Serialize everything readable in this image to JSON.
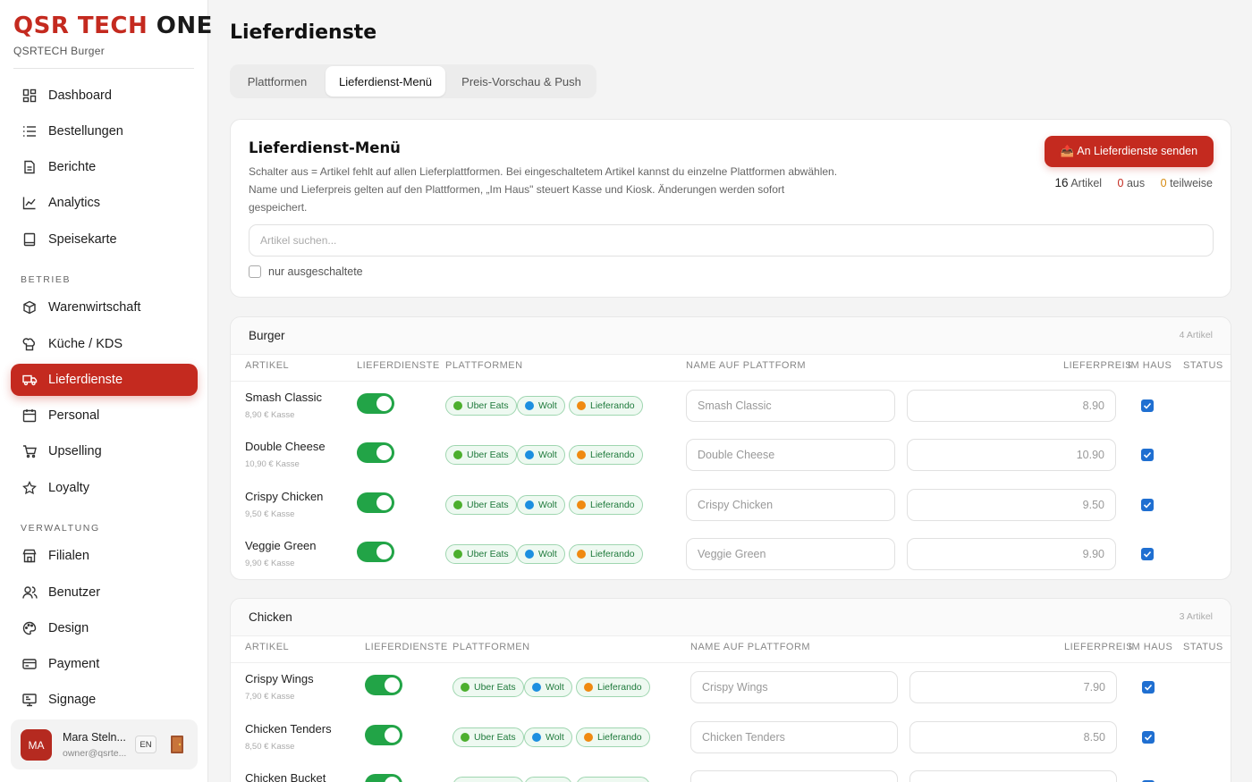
{
  "sidebar": {
    "brand": {
      "part1": "QSR TECH ",
      "part2": "ONE"
    },
    "subtitle": "QSRTECH Burger",
    "items": [
      {
        "label": "Dashboard",
        "icon": "dashboard-icon"
      },
      {
        "label": "Bestellungen",
        "icon": "list-icon"
      },
      {
        "label": "Berichte",
        "icon": "document-icon"
      },
      {
        "label": "Analytics",
        "icon": "chart-line-icon"
      },
      {
        "label": "Speisekarte",
        "icon": "book-icon"
      }
    ],
    "section_betrieb": "BETRIEB",
    "betrieb_items": [
      {
        "label": "Warenwirtschaft",
        "icon": "box-icon"
      },
      {
        "label": "Küche / KDS",
        "icon": "chef-hat-icon"
      },
      {
        "label": "Lieferdienste",
        "icon": "truck-icon"
      },
      {
        "label": "Personal",
        "icon": "calendar-icon"
      },
      {
        "label": "Upselling",
        "icon": "cart-icon"
      },
      {
        "label": "Loyalty",
        "icon": "star-icon"
      }
    ],
    "section_verwaltung": "VERWALTUNG",
    "verwaltung_items": [
      {
        "label": "Filialen",
        "icon": "store-icon"
      },
      {
        "label": "Benutzer",
        "icon": "users-icon"
      },
      {
        "label": "Design",
        "icon": "palette-icon"
      },
      {
        "label": "Payment",
        "icon": "credit-card-icon"
      },
      {
        "label": "Signage",
        "icon": "monitor-icon"
      }
    ],
    "user": {
      "initials": "MA",
      "name": "Mara Steln...",
      "email": "owner@qsrte...",
      "lang": "EN"
    }
  },
  "page": {
    "title": "Lieferdienste",
    "tabs": [
      "Plattformen",
      "Lieferdienst-Menü",
      "Preis-Vorschau & Push"
    ],
    "active_tab": "Lieferdienst-Menü"
  },
  "menu_card": {
    "title": "Lieferdienst-Menü",
    "description": "Schalter aus = Artikel fehlt auf allen Lieferplattformen. Bei eingeschaltetem Artikel kannst du einzelne Plattformen abwählen. Name und Lieferpreis gelten auf den Plattformen, „Im Haus\" steuert Kasse und Kiosk. Änderungen werden sofort gespeichert.",
    "send_button": "📤 An Lieferdienste senden",
    "stats": {
      "total": "16",
      "total_label": "Artikel",
      "off": "0",
      "off_label": "aus",
      "partial": "0",
      "partial_label": "teilweise"
    },
    "search_placeholder": "Artikel suchen...",
    "filter_label": "nur ausgeschaltete"
  },
  "columns": {
    "artikel": "ARTIKEL",
    "lieferdienste": "LIEFERDIENSTE",
    "plattformen": "PLATTFORMEN",
    "name_auf_plattform": "NAME AUF PLATTFORM",
    "lieferpreis": "LIEFERPREIS",
    "im_haus": "IM HAUS",
    "status": "STATUS"
  },
  "platforms": [
    {
      "name": "Uber Eats",
      "color": "#4caf2e"
    },
    {
      "name": "Wolt",
      "color": "#1d8fe0"
    },
    {
      "name": "Lieferando",
      "color": "#f08a12"
    }
  ],
  "categories": [
    {
      "name": "Burger",
      "count": "4 Artikel",
      "items": [
        {
          "name": "Smash Classic",
          "sub": "8,90 € Kasse",
          "platform_name": "Smash Classic",
          "price": "8.90"
        },
        {
          "name": "Double Cheese",
          "sub": "10,90 € Kasse",
          "platform_name": "Double Cheese",
          "price": "10.90"
        },
        {
          "name": "Crispy Chicken",
          "sub": "9,50 € Kasse",
          "platform_name": "Crispy Chicken",
          "price": "9.50"
        },
        {
          "name": "Veggie Green",
          "sub": "9,90 € Kasse",
          "platform_name": "Veggie Green",
          "price": "9.90"
        }
      ]
    },
    {
      "name": "Chicken",
      "count": "3 Artikel",
      "items": [
        {
          "name": "Crispy Wings",
          "sub": "7,90 € Kasse",
          "platform_name": "Crispy Wings",
          "price": "7.90"
        },
        {
          "name": "Chicken Tenders",
          "sub": "8,50 € Kasse",
          "platform_name": "Chicken Tenders",
          "price": "8.50"
        },
        {
          "name": "Chicken Bucket",
          "sub": "",
          "platform_name": "",
          "price": ""
        }
      ]
    }
  ]
}
